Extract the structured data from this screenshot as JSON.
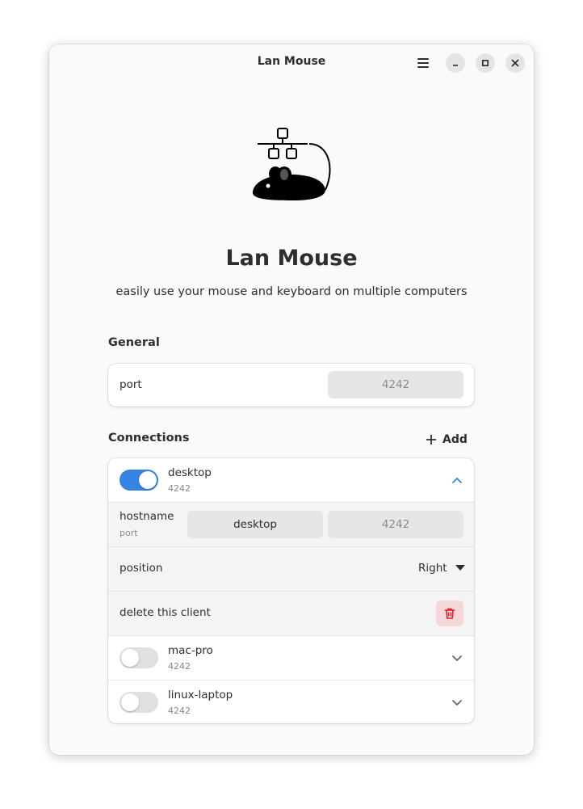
{
  "window": {
    "title": "Lan Mouse"
  },
  "app": {
    "name": "Lan Mouse",
    "description": "easily use your mouse and keyboard on multiple computers"
  },
  "general": {
    "title": "General",
    "port_label": "port",
    "port_placeholder": "4242"
  },
  "connections": {
    "title": "Connections",
    "add_label": "Add",
    "clients": [
      {
        "name": "desktop",
        "port": "4242",
        "enabled": true,
        "expanded": true,
        "hostname_label": "hostname",
        "port_label": "port",
        "hostname_value": "desktop",
        "port_placeholder": "4242",
        "position_label": "position",
        "position_value": "Right",
        "delete_label": "delete this client"
      },
      {
        "name": "mac-pro",
        "port": "4242",
        "enabled": false,
        "expanded": false
      },
      {
        "name": "linux-laptop",
        "port": "4242",
        "enabled": false,
        "expanded": false
      }
    ]
  },
  "colors": {
    "accent": "#3584e4",
    "destructive": "#e01b24",
    "destructive_bg": "#f4d8d9"
  }
}
